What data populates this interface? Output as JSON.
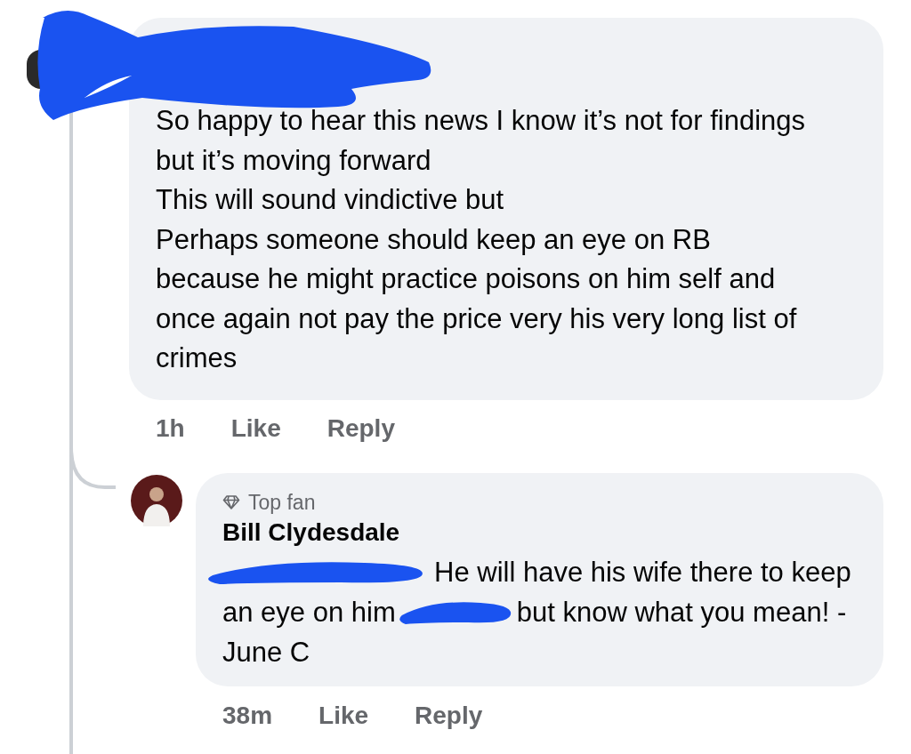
{
  "comment": {
    "paragraphs": [
      "So happy to hear this news  I know it’s not for findings but it’s moving forward",
      "This will sound vindictive but",
      "Perhaps someone should keep an eye on RB because he might practice poisons on him self and once again not pay the price very his very long list of crimes"
    ],
    "time": "1h",
    "actions": [
      "Like",
      "Reply"
    ],
    "reply": {
      "badge": "Top fan",
      "author": "Bill Clydesdale",
      "body": [
        {
          "kind": "redacted"
        },
        {
          "kind": "text",
          "text": "He will have his wife there to keep an eye on him"
        },
        {
          "kind": "redacted"
        },
        {
          "kind": "text",
          "text": "but know what you mean! - June C"
        }
      ],
      "time": "38m",
      "actions": [
        "Like",
        "Reply"
      ]
    }
  }
}
